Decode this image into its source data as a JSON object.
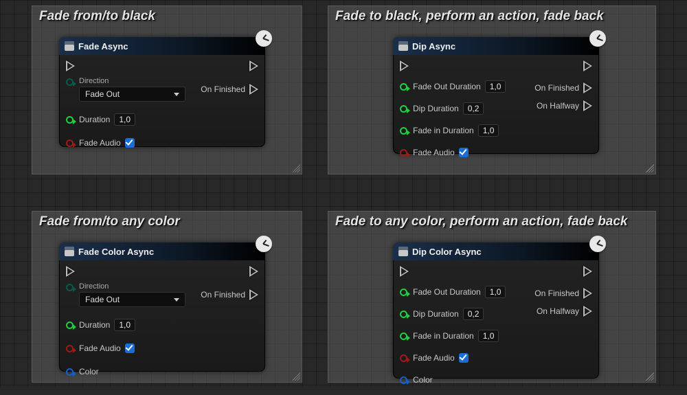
{
  "panels": [
    {
      "title": "Fade from/to black"
    },
    {
      "title": "Fade to black, perform an action, fade back"
    },
    {
      "title": "Fade from/to any color"
    },
    {
      "title": "Fade to any color, perform an action, fade back"
    }
  ],
  "nodes": {
    "fade_async": {
      "title": "Fade Async",
      "direction_label": "Direction",
      "direction_value": "Fade Out",
      "duration_label": "Duration",
      "duration_value": "1,0",
      "fade_audio_label": "Fade Audio",
      "out_finished": "On Finished"
    },
    "dip_async": {
      "title": "Dip Async",
      "fade_out_label": "Fade Out Duration",
      "fade_out_value": "1,0",
      "dip_label": "Dip Duration",
      "dip_value": "0,2",
      "fade_in_label": "Fade in Duration",
      "fade_in_value": "1,0",
      "fade_audio_label": "Fade Audio",
      "out_finished": "On Finished",
      "out_halfway": "On Halfway"
    },
    "fade_color_async": {
      "title": "Fade Color Async",
      "direction_label": "Direction",
      "direction_value": "Fade Out",
      "duration_label": "Duration",
      "duration_value": "1,0",
      "fade_audio_label": "Fade Audio",
      "color_label": "Color",
      "out_finished": "On Finished"
    },
    "dip_color_async": {
      "title": "Dip Color Async",
      "fade_out_label": "Fade Out Duration",
      "fade_out_value": "1,0",
      "dip_label": "Dip Duration",
      "dip_value": "0,2",
      "fade_in_label": "Fade in Duration",
      "fade_in_value": "1,0",
      "fade_audio_label": "Fade Audio",
      "color_label": "Color",
      "out_finished": "On Finished",
      "out_halfway": "On Halfway"
    }
  }
}
